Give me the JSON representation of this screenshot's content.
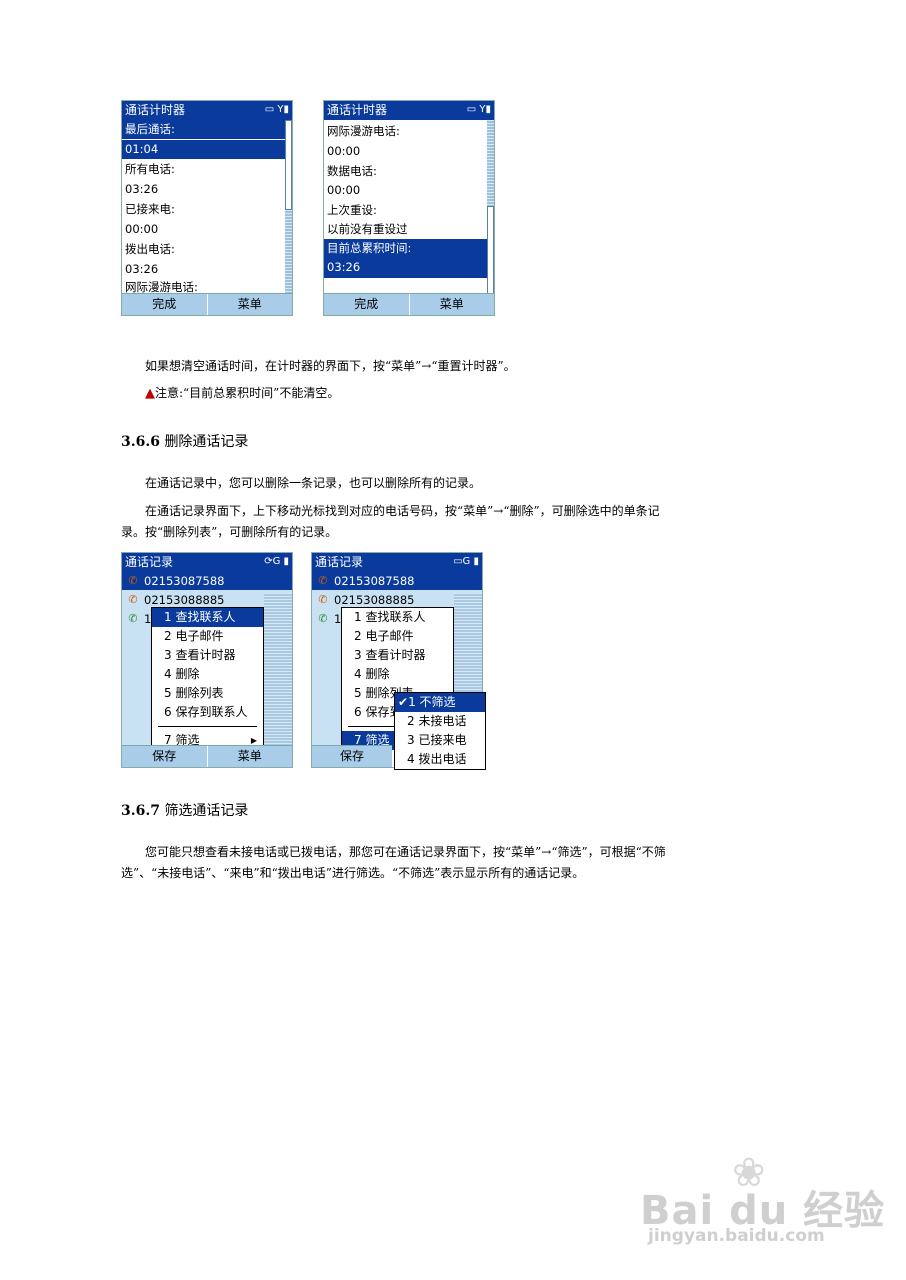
{
  "phone1": {
    "title": "通话计时器",
    "rows": [
      "最后通话:",
      "01:04",
      "所有电话:",
      "03:26",
      "已接来电:",
      "00:00",
      "拨出电话:",
      "03:26",
      "网际漫游电话:"
    ],
    "softkeys": [
      "完成",
      "菜单"
    ]
  },
  "phone2": {
    "title": "通话计时器",
    "rows": [
      "网际漫游电话:",
      "00:00",
      "数据电话:",
      "00:00",
      "上次重设:",
      "以前没有重设过",
      "目前总累积时间:",
      "03:26"
    ],
    "softkeys": [
      "完成",
      "菜单"
    ]
  },
  "text1": "如果想清空通话时间，在计时器的界面下，按“菜单”→“重置计时器”。",
  "note": "注意:“目前总累积时间”不能清空。",
  "section1": {
    "num": "3.6.6",
    "title": "删除通话记录"
  },
  "para1": "在通话记录中，您可以删除一条记录，也可以删除所有的记录。",
  "para2": "在通话记录界面下，上下移动光标找到对应的电话号码，按“菜单”→“删除”，可删除选中的单条记录。按“删除列表”，可删除所有的记录。",
  "phone3": {
    "title": "通话记录",
    "entries": [
      "02153087588",
      "02153088885",
      "1"
    ],
    "menu": [
      "1 查找联系人",
      "2 电子邮件",
      "3 查看计时器",
      "4 删除",
      "5 删除列表",
      "6 保存到联系人",
      "7 筛选"
    ],
    "softkeys": [
      "保存",
      "菜单"
    ]
  },
  "phone4": {
    "title": "通话记录",
    "entries": [
      "02153087588",
      "02153088885",
      "1"
    ],
    "menu": [
      "1 查找联系人",
      "2 电子邮件",
      "3 查看计时器",
      "4 删除",
      "5 删除列表",
      "6 保存到联系人",
      "7 筛选"
    ],
    "submenu": [
      "1 不筛选",
      "2 未接电话",
      "3 已接来电",
      "4 拨出电话"
    ],
    "softkeys": [
      "保存",
      "菜单"
    ]
  },
  "section2": {
    "num": "3.6.7",
    "title": "筛选通话记录"
  },
  "para3": "您可能只想查看未接电话或已拨电话，那您可在通话记录界面下，按“菜单”→“筛选”，可根据“不筛选”、“未接电话”、“来电”和“拨出电话”进行筛选。“不筛选”表示显示所有的通话记录。",
  "watermark": {
    "brand": "Bai du 经验",
    "url": "jingyan.baidu.com"
  }
}
